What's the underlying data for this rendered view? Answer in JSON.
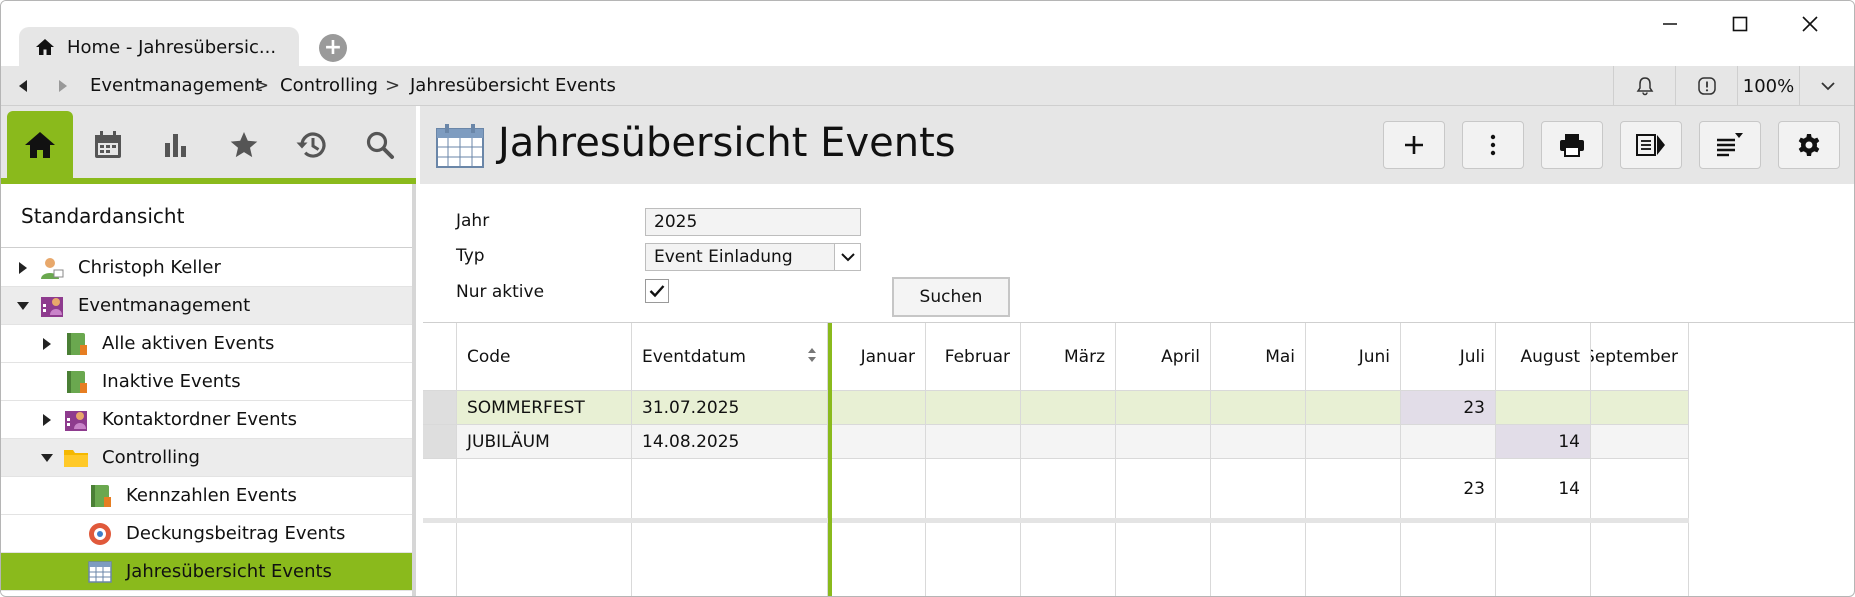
{
  "tab": {
    "title": "Home - Jahresübersic..."
  },
  "breadcrumb": [
    "Eventmanagement",
    "Controlling",
    "Jahresübersicht Events"
  ],
  "breadcrumb_sep": ">",
  "zoom": "100%",
  "sidebar": {
    "tabs": [
      "home-icon",
      "calendar-icon",
      "bar-chart-icon",
      "star-icon",
      "history-icon",
      "search-icon"
    ],
    "header": "Standardansicht",
    "items": [
      {
        "label": "Christoph Keller",
        "icon": "person-icon",
        "caret": "right"
      },
      {
        "label": "Eventmanagement",
        "icon": "event-group-icon",
        "caret": "down"
      },
      {
        "label": "Alle aktiven Events",
        "icon": "event-list-icon",
        "caret": "right"
      },
      {
        "label": "Inaktive Events",
        "icon": "event-list-icon",
        "caret": ""
      },
      {
        "label": "Kontaktordner Events",
        "icon": "contact-folder-icon",
        "caret": "right"
      },
      {
        "label": "Controlling",
        "icon": "folder-icon",
        "caret": "down"
      },
      {
        "label": "Kennzahlen Events",
        "icon": "event-list-icon",
        "caret": ""
      },
      {
        "label": "Deckungsbeitrag Events",
        "icon": "contribution-icon",
        "caret": ""
      },
      {
        "label": "Jahresübersicht Events",
        "icon": "calendar-grid-icon",
        "caret": ""
      }
    ]
  },
  "main": {
    "title": "Jahresübersicht Events",
    "toolbar": [
      "add-icon",
      "more-icon",
      "print-icon",
      "export-icon",
      "sort-list-icon",
      "gear-icon"
    ]
  },
  "filters": {
    "year_label": "Jahr",
    "year_value": "2025",
    "type_label": "Typ",
    "type_value": "Event Einladung",
    "active_label": "Nur aktive",
    "active_checked": true,
    "search_button": "Suchen"
  },
  "grid": {
    "columns": [
      "Code",
      "Eventdatum",
      "Januar",
      "Februar",
      "März",
      "April",
      "Mai",
      "Juni",
      "Juli",
      "August",
      "September"
    ],
    "rows": [
      {
        "code": "SOMMERFEST",
        "date": "31.07.2025",
        "months": [
          "",
          "",
          "",
          "",
          "",
          "",
          "23",
          "",
          ""
        ]
      },
      {
        "code": "JUBILÄUM",
        "date": "14.08.2025",
        "months": [
          "",
          "",
          "",
          "",
          "",
          "",
          "",
          "14",
          ""
        ]
      }
    ],
    "totals": [
      "",
      "",
      "",
      "",
      "",
      "",
      "23",
      "14",
      ""
    ]
  },
  "colors": {
    "accent": "#8aba1c",
    "row_highlight": "#e8f0d4",
    "cell_highlight": "#e2dde8"
  }
}
